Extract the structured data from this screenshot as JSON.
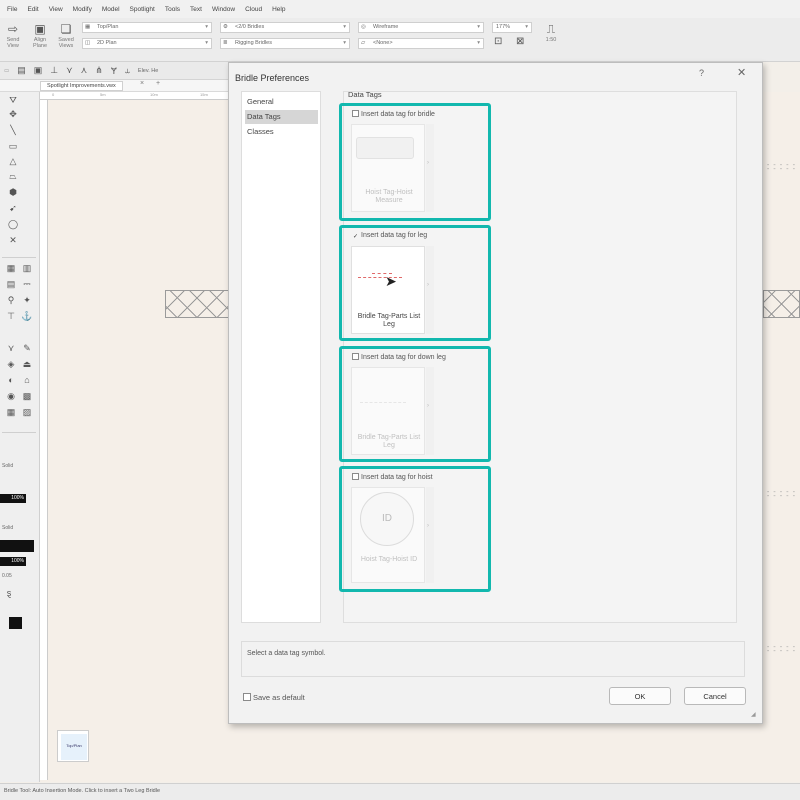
{
  "menubar": [
    "File",
    "Edit",
    "View",
    "Modify",
    "Model",
    "Spotlight",
    "Tools",
    "Text",
    "Window",
    "Cloud",
    "Help"
  ],
  "toolbar": {
    "send_label": "Send View",
    "align_label": "Align Plane",
    "saved_views_label": "Saved Views",
    "view_select": "Top/Plan",
    "plane_select": "2D Plan",
    "class_select": "<2/0 Bridles",
    "layer_select": "Rigging Bridles",
    "render_select": "Wireframe",
    "projection_select": "<None>",
    "zoom_select": "177%",
    "scale_label": "1:50"
  },
  "modebar": {
    "label": "Elev. He"
  },
  "tabs": {
    "active": "Spotlight Improvements.vwx"
  },
  "ruler": [
    "0",
    "5m",
    "10m",
    "15m"
  ],
  "palette": {
    "fill_label": "Solid",
    "opacity1": "100%",
    "pen_label": "Solid",
    "opacity2": "100%",
    "weight_label": "0.05"
  },
  "thumb_label": "Top/Plan",
  "statusbar": "Bridle Tool: Auto Insertion Mode. Click to insert a Two Leg Bridle",
  "dialog": {
    "title": "Bridle Preferences",
    "help": "?",
    "close": "✕",
    "nav": [
      {
        "label": "General",
        "selected": false
      },
      {
        "label": "Data Tags",
        "selected": true
      },
      {
        "label": "Classes",
        "selected": false
      }
    ],
    "content_header": "Data Tags",
    "tags": [
      {
        "check_label": "Insert data tag for bridle",
        "checked": false,
        "preview": "Hoist Tag-Hoist Measure"
      },
      {
        "check_label": "Insert data tag for leg",
        "checked": true,
        "preview": "Bridle Tag-Parts List Leg"
      },
      {
        "check_label": "Insert data tag for down leg",
        "checked": false,
        "preview": "Bridle Tag-Parts List Leg"
      },
      {
        "check_label": "Insert data tag for hoist",
        "checked": false,
        "preview": "Hoist Tag-Hoist ID"
      }
    ],
    "hoist_symbol": "ID",
    "hint": "Select a data tag symbol.",
    "save_default": "Save as default",
    "ok": "OK",
    "cancel": "Cancel"
  },
  "colors": {
    "highlight": "#12b8ae",
    "canvas": "#f5efe8",
    "dialog_bg": "#f2f2f2"
  }
}
